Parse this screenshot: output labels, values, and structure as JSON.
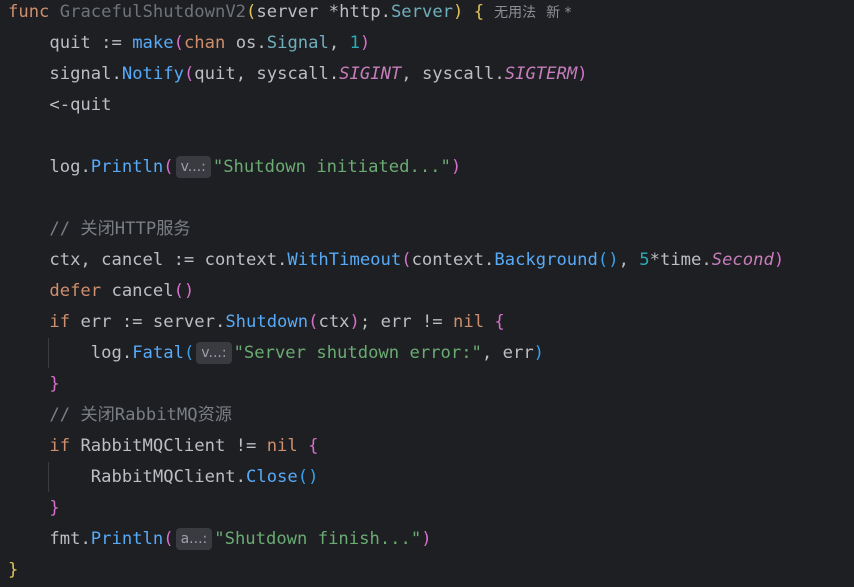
{
  "editor": {
    "theme_background": "#1e1f22",
    "lines": [
      {
        "tokens": [
          {
            "t": "func ",
            "c": "kw"
          },
          {
            "t": "GracefulShutdownV2",
            "c": "unused"
          },
          {
            "t": "(",
            "c": "p1"
          },
          {
            "t": "server *",
            "c": ""
          },
          {
            "t": "http",
            "c": "pkg"
          },
          {
            "t": ".",
            "c": ""
          },
          {
            "t": "Server",
            "c": "type"
          },
          {
            "t": ")",
            "c": "p1"
          },
          {
            "t": " {",
            "c": "p1"
          },
          {
            "t": "无用法",
            "c": "meta"
          },
          {
            "t": "新 *",
            "c": "meta"
          }
        ]
      },
      {
        "tokens": [
          {
            "t": "    quit := ",
            "c": ""
          },
          {
            "t": "make",
            "c": "fn"
          },
          {
            "t": "(",
            "c": "p2"
          },
          {
            "t": "chan ",
            "c": "kw"
          },
          {
            "t": "os",
            "c": ""
          },
          {
            "t": ".",
            "c": ""
          },
          {
            "t": "Signal",
            "c": "type"
          },
          {
            "t": ", ",
            "c": ""
          },
          {
            "t": "1",
            "c": "num"
          },
          {
            "t": ")",
            "c": "p2"
          }
        ]
      },
      {
        "tokens": [
          {
            "t": "    signal",
            "c": ""
          },
          {
            "t": ".",
            "c": ""
          },
          {
            "t": "Notify",
            "c": "call"
          },
          {
            "t": "(",
            "c": "p2"
          },
          {
            "t": "quit, syscall.",
            "c": ""
          },
          {
            "t": "SIGINT",
            "c": "const"
          },
          {
            "t": ", syscall.",
            "c": ""
          },
          {
            "t": "SIGTERM",
            "c": "const"
          },
          {
            "t": ")",
            "c": "p2"
          }
        ]
      },
      {
        "tokens": [
          {
            "t": "    <-quit",
            "c": ""
          }
        ]
      },
      {
        "tokens": []
      },
      {
        "tokens": [
          {
            "t": "    log",
            "c": ""
          },
          {
            "t": ".",
            "c": ""
          },
          {
            "t": "Println",
            "c": "call"
          },
          {
            "t": "(",
            "c": "p2"
          },
          {
            "t": "v...:",
            "c": "hint"
          },
          {
            "t": "\"Shutdown initiated...\"",
            "c": "str"
          },
          {
            "t": ")",
            "c": "p2"
          }
        ]
      },
      {
        "tokens": []
      },
      {
        "tokens": [
          {
            "t": "    // 关闭HTTP服务",
            "c": "cmt"
          }
        ]
      },
      {
        "tokens": [
          {
            "t": "    ctx, cancel := context.",
            "c": ""
          },
          {
            "t": "WithTimeout",
            "c": "call"
          },
          {
            "t": "(",
            "c": "p2"
          },
          {
            "t": "context.",
            "c": ""
          },
          {
            "t": "Background",
            "c": "call"
          },
          {
            "t": "()",
            "c": "p3"
          },
          {
            "t": ", ",
            "c": ""
          },
          {
            "t": "5",
            "c": "num"
          },
          {
            "t": "*time.",
            "c": ""
          },
          {
            "t": "Second",
            "c": "const"
          },
          {
            "t": ")",
            "c": "p2"
          }
        ]
      },
      {
        "tokens": [
          {
            "t": "    defer ",
            "c": "kw"
          },
          {
            "t": "cancel",
            "c": ""
          },
          {
            "t": "()",
            "c": "p2"
          }
        ]
      },
      {
        "tokens": [
          {
            "t": "    if ",
            "c": "kw"
          },
          {
            "t": "err := server.",
            "c": ""
          },
          {
            "t": "Shutdown",
            "c": "call"
          },
          {
            "t": "(",
            "c": "p2"
          },
          {
            "t": "ctx",
            "c": ""
          },
          {
            "t": ")",
            "c": "p2"
          },
          {
            "t": "; err != ",
            "c": ""
          },
          {
            "t": "nil",
            "c": "kw"
          },
          {
            "t": " {",
            "c": "p2"
          }
        ]
      },
      {
        "tokens": [
          {
            "t": "        log.",
            "c": ""
          },
          {
            "t": "Fatal",
            "c": "call"
          },
          {
            "t": "(",
            "c": "p3"
          },
          {
            "t": "v...:",
            "c": "hint"
          },
          {
            "t": "\"Server shutdown error:\"",
            "c": "str"
          },
          {
            "t": ", err",
            "c": ""
          },
          {
            "t": ")",
            "c": "p3"
          }
        ]
      },
      {
        "tokens": [
          {
            "t": "    }",
            "c": "p2"
          }
        ]
      },
      {
        "tokens": [
          {
            "t": "    // 关闭RabbitMQ资源",
            "c": "cmt"
          }
        ]
      },
      {
        "tokens": [
          {
            "t": "    if ",
            "c": "kw"
          },
          {
            "t": "RabbitMQClient != ",
            "c": ""
          },
          {
            "t": "nil",
            "c": "kw"
          },
          {
            "t": " {",
            "c": "p2"
          }
        ]
      },
      {
        "tokens": [
          {
            "t": "        RabbitMQClient.",
            "c": ""
          },
          {
            "t": "Close",
            "c": "call"
          },
          {
            "t": "()",
            "c": "p3"
          }
        ]
      },
      {
        "tokens": [
          {
            "t": "    }",
            "c": "p2"
          }
        ]
      },
      {
        "tokens": [
          {
            "t": "    fmt",
            "c": ""
          },
          {
            "t": ".",
            "c": ""
          },
          {
            "t": "Println",
            "c": "call"
          },
          {
            "t": "(",
            "c": "p2"
          },
          {
            "t": "a...:",
            "c": "hint"
          },
          {
            "t": "\"Shutdown finish...\"",
            "c": "str"
          },
          {
            "t": ")",
            "c": "p2"
          }
        ]
      },
      {
        "tokens": [
          {
            "t": "}",
            "c": "p1"
          }
        ]
      }
    ]
  }
}
